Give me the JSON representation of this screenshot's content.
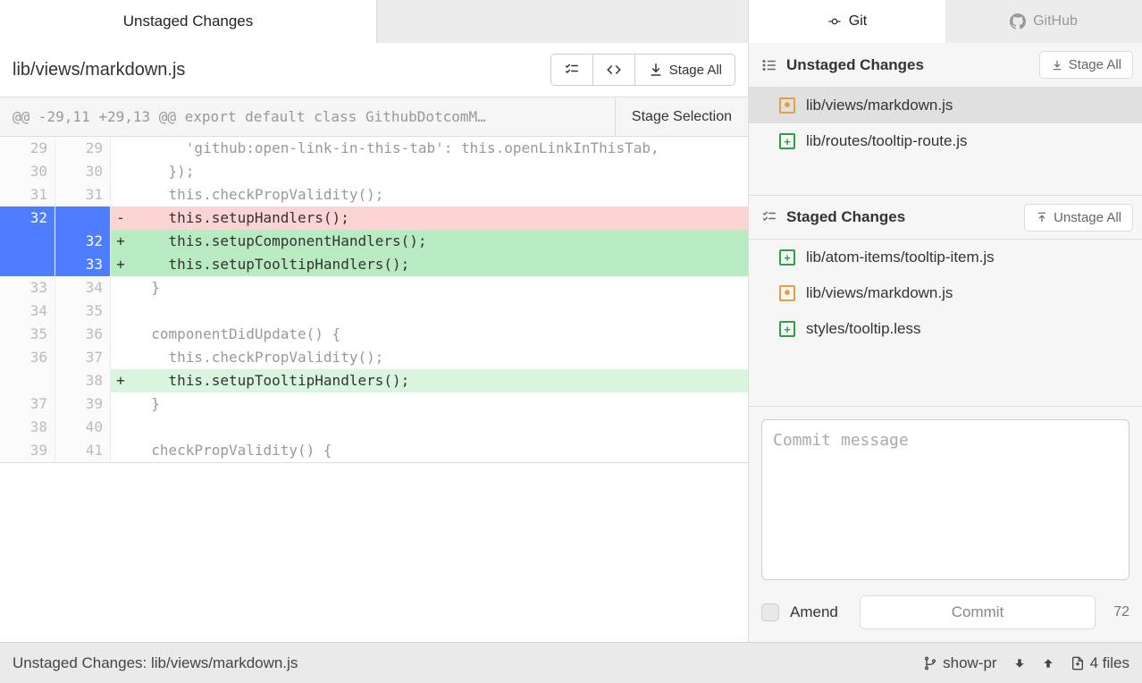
{
  "left": {
    "tab_label": "Unstaged Changes",
    "file_path": "lib/views/markdown.js",
    "stage_all_label": "Stage All",
    "hunk_header": "@@ -29,11 +29,13 @@ export default class GithubDotcomM…",
    "stage_selection_label": "Stage Selection"
  },
  "diff": [
    {
      "old": "29",
      "new": "29",
      "type": "context",
      "marker": " ",
      "code": "      'github:open-link-in-this-tab': this.openLinkInThisTab,"
    },
    {
      "old": "30",
      "new": "30",
      "type": "context",
      "marker": " ",
      "code": "    });"
    },
    {
      "old": "31",
      "new": "31",
      "type": "context",
      "marker": " ",
      "code": "    this.checkPropValidity();"
    },
    {
      "old": "32",
      "new": "",
      "type": "deletion",
      "marker": "-",
      "code": "    this.setupHandlers();"
    },
    {
      "old": "",
      "new": "32",
      "type": "addition",
      "selected": true,
      "marker": "+",
      "code": "    this.setupComponentHandlers();"
    },
    {
      "old": "",
      "new": "33",
      "type": "addition",
      "selected": true,
      "marker": "+",
      "code": "    this.setupTooltipHandlers();"
    },
    {
      "old": "33",
      "new": "34",
      "type": "context",
      "marker": " ",
      "code": "  }"
    },
    {
      "old": "34",
      "new": "35",
      "type": "context",
      "marker": " ",
      "code": ""
    },
    {
      "old": "35",
      "new": "36",
      "type": "context",
      "marker": " ",
      "code": "  componentDidUpdate() {"
    },
    {
      "old": "36",
      "new": "37",
      "type": "context",
      "marker": " ",
      "code": "    this.checkPropValidity();"
    },
    {
      "old": "",
      "new": "38",
      "type": "addition-light",
      "marker": "+",
      "code": "    this.setupTooltipHandlers();"
    },
    {
      "old": "37",
      "new": "39",
      "type": "context",
      "marker": " ",
      "code": "  }"
    },
    {
      "old": "38",
      "new": "40",
      "type": "context",
      "marker": " ",
      "code": ""
    },
    {
      "old": "39",
      "new": "41",
      "type": "context",
      "marker": " ",
      "code": "  checkPropValidity() {"
    }
  ],
  "right": {
    "tabs": {
      "git": "Git",
      "github": "GitHub"
    },
    "unstaged": {
      "title": "Unstaged Changes",
      "button": "Stage All",
      "files": [
        {
          "status": "modified",
          "path": "lib/views/markdown.js",
          "selected": true
        },
        {
          "status": "added",
          "path": "lib/routes/tooltip-route.js"
        }
      ]
    },
    "staged": {
      "title": "Staged Changes",
      "button": "Unstage All",
      "files": [
        {
          "status": "added",
          "path": "lib/atom-items/tooltip-item.js"
        },
        {
          "status": "modified",
          "path": "lib/views/markdown.js"
        },
        {
          "status": "added",
          "path": "styles/tooltip.less"
        }
      ]
    },
    "commit": {
      "placeholder": "Commit message",
      "amend_label": "Amend",
      "commit_label": "Commit",
      "char_count": "72"
    }
  },
  "status": {
    "left": "Unstaged Changes: lib/views/markdown.js",
    "branch": "show-pr",
    "files": "4 files"
  }
}
